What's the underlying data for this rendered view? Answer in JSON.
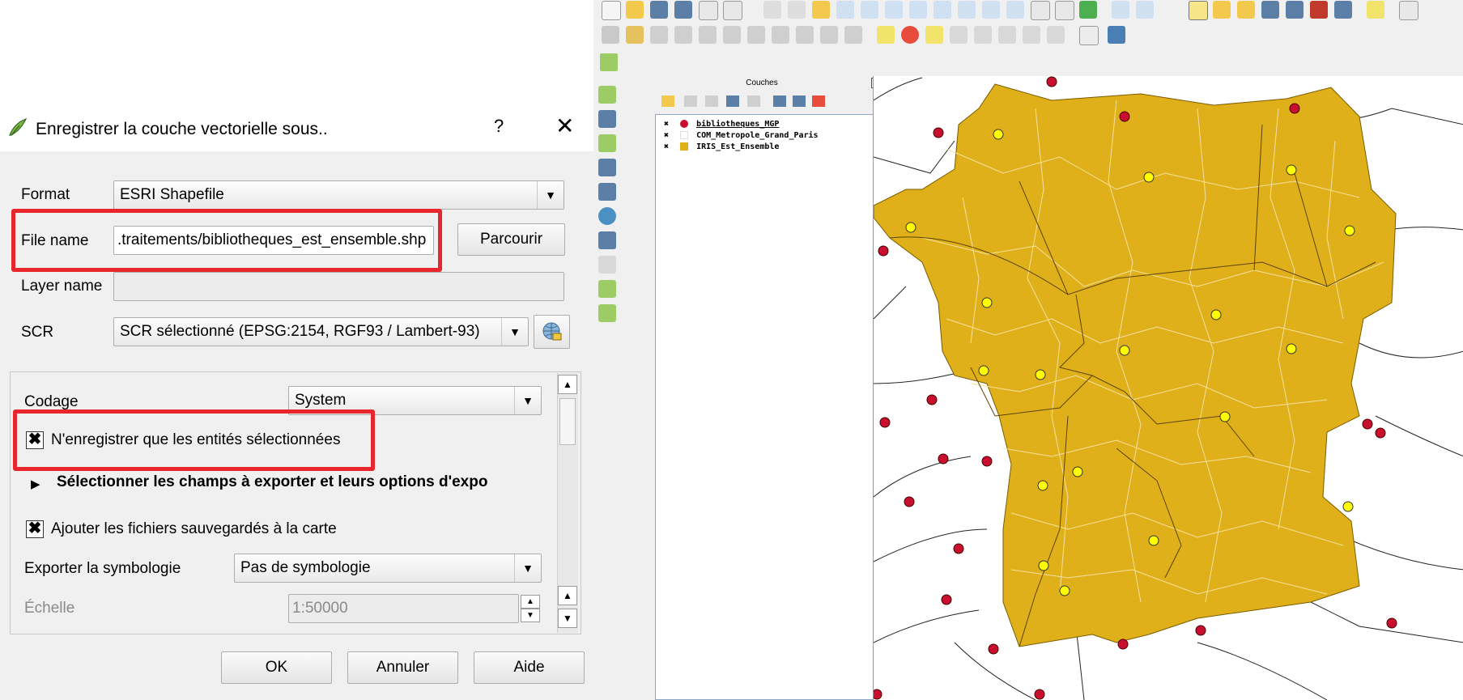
{
  "dialog": {
    "title": "Enregistrer la couche vectorielle sous..",
    "help": "?",
    "close": "✕",
    "format_label": "Format",
    "format_value": "ESRI Shapefile",
    "filename_label": "File name",
    "filename_value": ".traitements/bibliotheques_est_ensemble.shp",
    "browse_button": "Parcourir",
    "layername_label": "Layer name",
    "layername_value": "",
    "crs_label": "SCR",
    "crs_value": "SCR sélectionné (EPSG:2154, RGF93 / Lambert-93)",
    "encoding_label": "Codage",
    "encoding_value": "System",
    "selected_only_label": "N'enregistrer que les entités sélectionnées",
    "selected_only_checked": true,
    "fields_section_label": "Sélectionner les champs à exporter et leurs options d'expo",
    "add_to_map_label": "Ajouter les fichiers sauvegardés à la carte",
    "add_to_map_checked": true,
    "symbology_label": "Exporter la symbologie",
    "symbology_value": "Pas de symbologie",
    "scale_label": "Échelle",
    "scale_value": "1:50000",
    "ok_button": "OK",
    "cancel_button": "Annuler",
    "help_button": "Aide",
    "highlight_color": "#e8262c"
  },
  "qgis": {
    "layers_panel_title": "Couches",
    "layers": [
      {
        "name": "bibliotheques_MGP",
        "color": "#c8102e",
        "symbol": "circle",
        "checked": true
      },
      {
        "name": "COM_Metropole_Grand_Paris",
        "color": "#ffffff",
        "symbol": "square",
        "checked": true
      },
      {
        "name": "IRIS_Est_Ensemble",
        "color": "#e0b01a",
        "symbol": "square",
        "checked": true
      }
    ],
    "map": {
      "fill_color": "#e0b01a",
      "selected_point_color": "#ffff00",
      "point_color": "#c8102e"
    }
  }
}
